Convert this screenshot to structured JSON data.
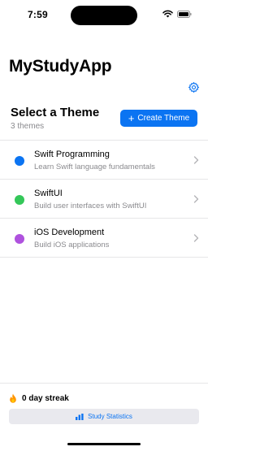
{
  "status_bar": {
    "time": "7:59",
    "icons": [
      "wifi-icon",
      "battery-icon"
    ]
  },
  "header": {
    "title": "MyStudyApp",
    "settings_icon": "gear-icon"
  },
  "section": {
    "title": "Select a Theme",
    "count": "3 themes",
    "create_button": {
      "icon": "plus-icon",
      "label": "Create Theme"
    }
  },
  "themes": [
    {
      "name": "Swift Programming",
      "description": "Learn Swift language fundamentals",
      "color": "#0b74f2"
    },
    {
      "name": "SwiftUI",
      "description": "Build user interfaces with SwiftUI",
      "color": "#34c759"
    },
    {
      "name": "iOS Development",
      "description": "Build iOS applications",
      "color": "#af52de"
    }
  ],
  "footer": {
    "streak_icon": "flame-icon",
    "streak_label": "0 day streak",
    "stats_button": {
      "icon": "bar-chart-icon",
      "label": "Study Statistics"
    }
  },
  "colors": {
    "accent": "#0b74f2",
    "secondary_text": "#8a8a8e",
    "separator": "#e6e6e8",
    "button_background": "#e9e9ee"
  }
}
